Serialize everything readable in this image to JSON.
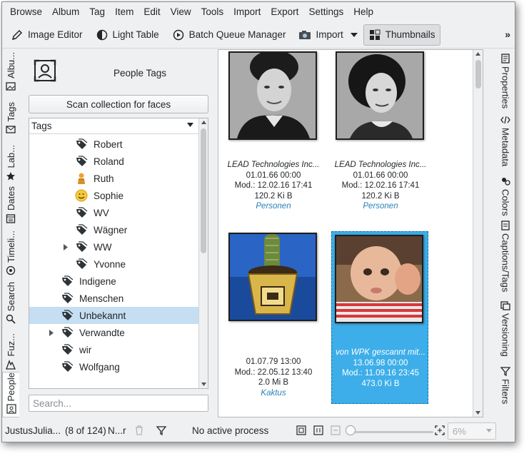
{
  "menu": [
    "Browse",
    "Album",
    "Tag",
    "Item",
    "Edit",
    "View",
    "Tools",
    "Import",
    "Export",
    "Settings",
    "Help"
  ],
  "toolbar": {
    "image_editor": "Image Editor",
    "light_table": "Light Table",
    "batch_queue": "Batch Queue Manager",
    "import": "Import",
    "thumbnails": "Thumbnails",
    "more": "»"
  },
  "left_tabs": [
    "Albu...",
    "Tags",
    "Lab...",
    "Dates",
    "Timeli...",
    "Search",
    "Fuz...",
    "People"
  ],
  "panel": {
    "title": "People Tags",
    "scan_button": "Scan collection for faces",
    "tree_header": "Tags",
    "search_placeholder": "Search..."
  },
  "tags": [
    {
      "label": "Robert",
      "level": 2,
      "icon": "tag-icon"
    },
    {
      "label": "Roland",
      "level": 2,
      "icon": "tag-icon"
    },
    {
      "label": "Ruth",
      "level": 2,
      "icon": "person-avatar-icon"
    },
    {
      "label": "Sophie",
      "level": 2,
      "icon": "smiley-avatar-icon"
    },
    {
      "label": "WV",
      "level": 2,
      "icon": "tag-icon"
    },
    {
      "label": "Wägner",
      "level": 2,
      "icon": "tag-icon"
    },
    {
      "label": "WW",
      "level": 2,
      "icon": "tag-icon",
      "expandable": true
    },
    {
      "label": "Yvonne",
      "level": 2,
      "icon": "tag-icon"
    },
    {
      "label": "Indigene",
      "level": 1,
      "icon": "tag-icon"
    },
    {
      "label": "Menschen",
      "level": 1,
      "icon": "tag-icon"
    },
    {
      "label": "Unbekannt",
      "level": 1,
      "icon": "tag-icon",
      "selected": true
    },
    {
      "label": "Verwandte",
      "level": 1,
      "icon": "tag-icon",
      "expandable": true
    },
    {
      "label": "wir",
      "level": 1,
      "icon": "tag-icon"
    },
    {
      "label": "Wolfgang",
      "level": 1,
      "icon": "tag-icon"
    }
  ],
  "thumbnails": [
    {
      "title": "LEAD Technologies Inc...",
      "date": "01.01.66 00:00",
      "modified": "Mod.: 12.02.16 17:41",
      "size": "120.2 Ki B",
      "tag": "Personen"
    },
    {
      "title": "LEAD Technologies Inc...",
      "date": "01.01.66 00:00",
      "modified": "Mod.: 12.02.16 17:41",
      "size": "120.2 Ki B",
      "tag": "Personen"
    },
    {
      "title": "",
      "date": "01.07.79 13:00",
      "modified": "Mod.: 22.05.12 13:40",
      "size": "2.0 Mi B",
      "tag": "Kaktus"
    },
    {
      "title": "von WPK gescannt mit...",
      "date": "13.06.98 00:00",
      "modified": "Mod.: 11.09.16 23:45",
      "size": "473.0 Ki B",
      "tag": ""
    }
  ],
  "right_tabs": [
    "Properties",
    "Metadata",
    "Colors",
    "Captions/Tags",
    "Versioning",
    "Filters"
  ],
  "status": {
    "album": "JustusJulia...",
    "count": "(8 of 124)",
    "filter_text": "N...r",
    "process": "No active process",
    "zoom": "6%"
  },
  "colors": {
    "selection": "#3daee9",
    "tree_selection": "#c5def2",
    "tag_link": "#2980b9"
  }
}
